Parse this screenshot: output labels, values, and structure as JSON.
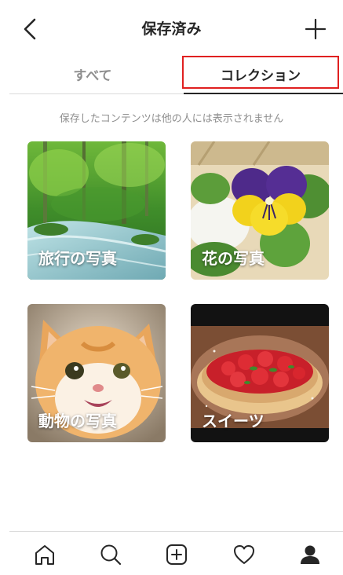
{
  "header": {
    "title": "保存済み",
    "back_icon": "chevron-left-icon",
    "add_icon": "plus-icon"
  },
  "tabs": [
    {
      "label": "すべて",
      "active": false
    },
    {
      "label": "コレクション",
      "active": true
    }
  ],
  "notice": "保存したコンテンツは他の人には表示されません",
  "collections": [
    {
      "label": "旅行の写真",
      "image": "forest-stream"
    },
    {
      "label": "花の写真",
      "image": "pansy-flower"
    },
    {
      "label": "動物の写真",
      "image": "kitten"
    },
    {
      "label": "スイーツ",
      "image": "strawberry-tart"
    }
  ],
  "bottom_nav": [
    {
      "icon": "home-icon"
    },
    {
      "icon": "search-icon"
    },
    {
      "icon": "new-post-icon"
    },
    {
      "icon": "heart-icon"
    },
    {
      "icon": "profile-icon",
      "active": true
    }
  ],
  "colors": {
    "text": "#262626",
    "muted": "#8e8e8e",
    "divider": "#dbdbdb",
    "highlight": "#e02020"
  }
}
